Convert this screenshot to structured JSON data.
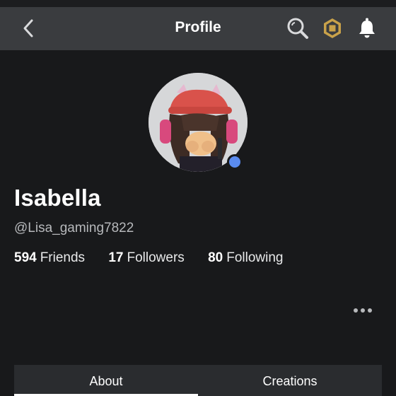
{
  "header": {
    "title": "Profile",
    "icons": [
      "back-chevron-icon",
      "search-icon",
      "robux-icon",
      "bell-icon"
    ]
  },
  "profile": {
    "display_name": "Isabella",
    "username": "@Lisa_gaming7822",
    "online": true
  },
  "stats": [
    {
      "count": "594",
      "label": "Friends"
    },
    {
      "count": "17",
      "label": "Followers"
    },
    {
      "count": "80",
      "label": "Following"
    }
  ],
  "tabs": [
    {
      "label": "About",
      "active": true
    },
    {
      "label": "Creations",
      "active": false
    }
  ],
  "colors": {
    "background": "#18191b",
    "header": "#3a3c3f",
    "presence": "#5a8bf0",
    "robux_gold": "#c9a24a"
  }
}
